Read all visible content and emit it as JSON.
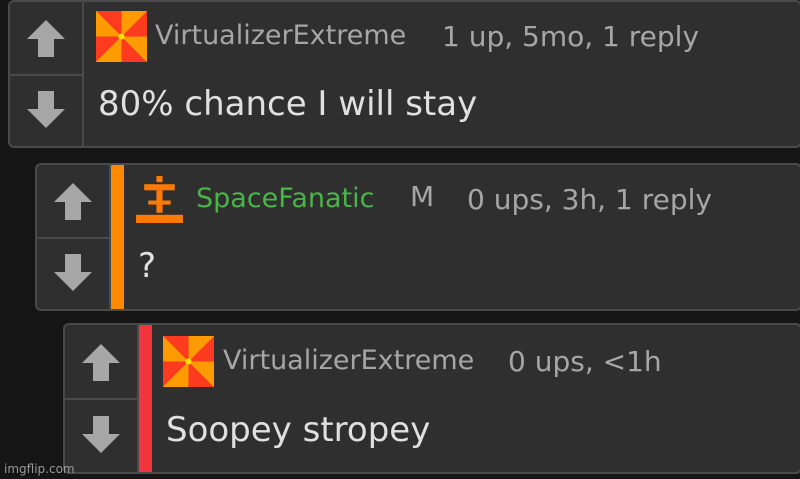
{
  "colors": {
    "background": "#151515",
    "card": "#2f2f2f",
    "border": "#4a4a4a",
    "mod_name": "#49b549",
    "stripe_orange": "#ff8a00",
    "stripe_red": "#f2353a",
    "muted_text": "#a6a6a6",
    "body_text": "#e0e0e0"
  },
  "comments": [
    {
      "username": "VirtualizerExtreme",
      "meta": "1 up, 5mo, 1 reply",
      "text": "80% chance I will stay",
      "avatar": "pinwheel-avatar"
    },
    {
      "username": "SpaceFanatic",
      "badge": "M",
      "meta": "0 ups, 3h, 1 reply",
      "text": "?",
      "avatar": "pixel-totem-avatar"
    },
    {
      "username": "VirtualizerExtreme",
      "meta": "0 ups, <1h",
      "text": "Soopey stropey",
      "avatar": "pinwheel-avatar"
    }
  ],
  "icons": {
    "upvote": "arrow-up-icon",
    "downvote": "arrow-down-icon"
  },
  "watermark": "imgflip.com"
}
